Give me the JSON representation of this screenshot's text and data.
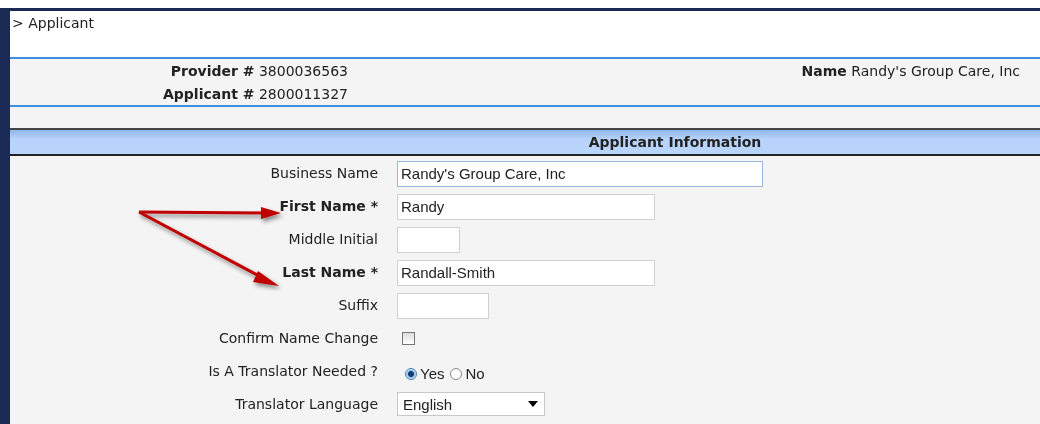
{
  "breadcrumb": "> Applicant",
  "info": {
    "provider_label": "Provider #",
    "provider_value": "3800036563",
    "applicant_label": "Applicant #",
    "applicant_value": "2800011327",
    "name_label": "Name",
    "name_value": "Randy's Group Care, Inc"
  },
  "section_title": "Applicant Information",
  "fields": [
    {
      "kind": "text",
      "label": "Business Name",
      "required": false,
      "value": "Randy's Group Care, Inc"
    },
    {
      "kind": "text",
      "label": "First Name *",
      "required": true,
      "value": "Randy"
    },
    {
      "kind": "text",
      "label": "Middle Initial",
      "required": false
    },
    {
      "kind": "text",
      "label": "Last Name *",
      "required": true,
      "value": "Randall-Smith"
    },
    {
      "kind": "text",
      "label": "Suffix",
      "required": false
    },
    {
      "kind": "checkbox",
      "label": "Confirm Name Change",
      "checked": false
    },
    {
      "kind": "radio",
      "label": "Is A Translator Needed ?",
      "options": [
        {
          "label": "Yes",
          "selected": true
        },
        {
          "label": "No",
          "selected": false
        }
      ]
    },
    {
      "kind": "select",
      "label": "Translator Language",
      "value": "English"
    }
  ]
}
